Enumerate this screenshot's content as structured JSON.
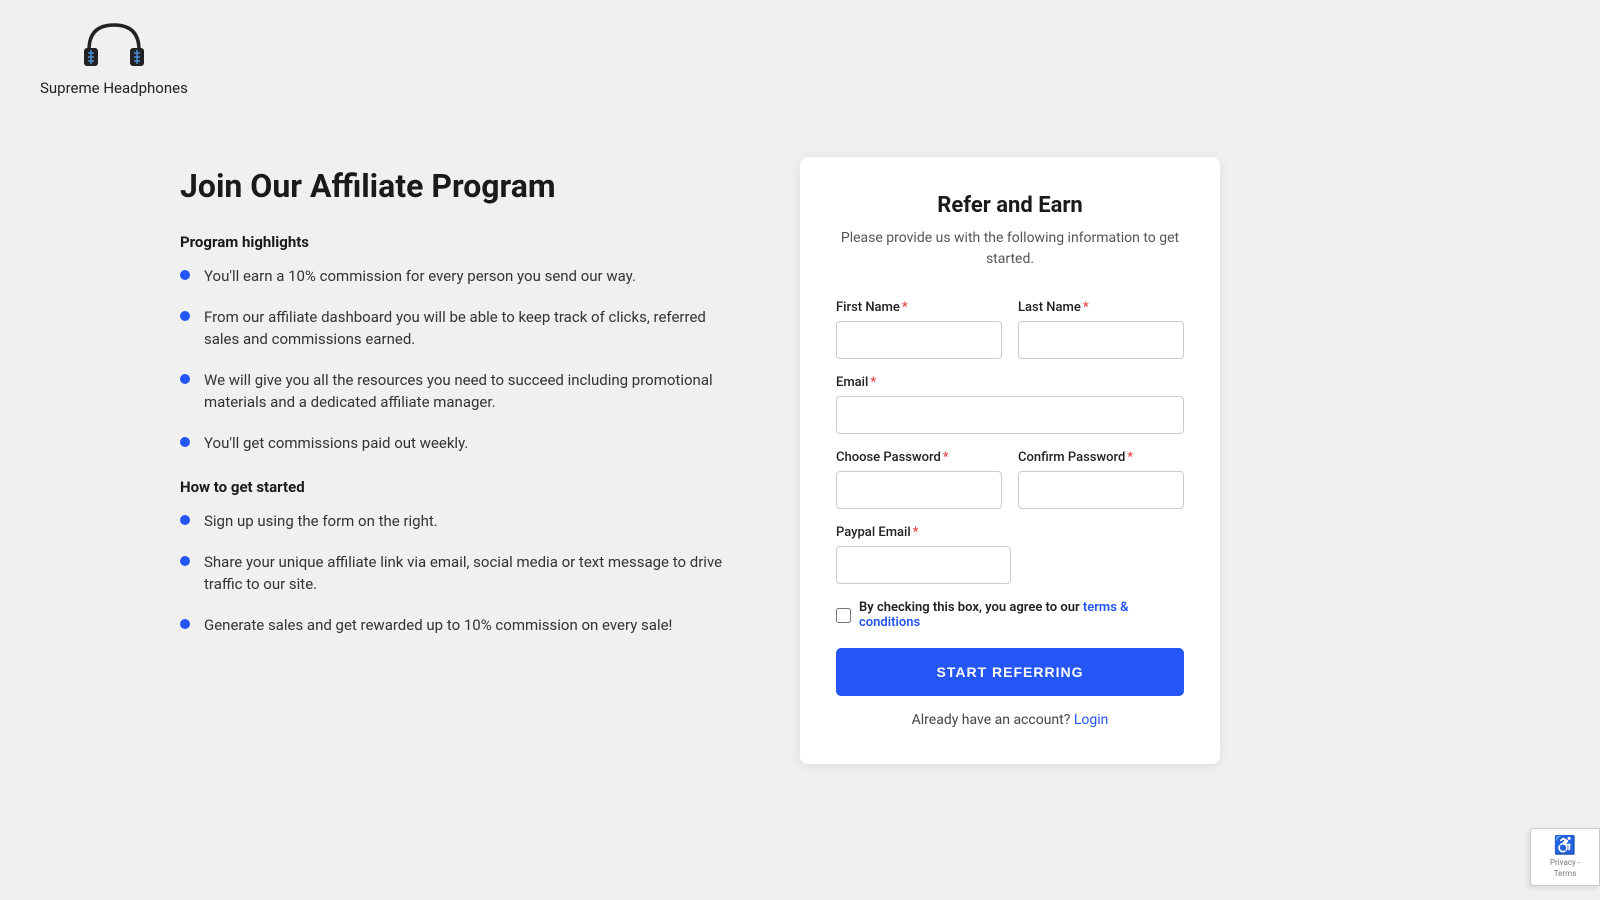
{
  "header": {
    "logo_text": "Supreme Headphones"
  },
  "left": {
    "page_title": "Join Our Affiliate Program",
    "highlights_heading": "Program highlights",
    "highlights": [
      "You'll earn a 10% commission for every person you send our way.",
      "From our affiliate dashboard you will be able to keep track of clicks, referred sales and commissions earned.",
      "We will give you all the resources you need to succeed including promotional materials and a dedicated affiliate manager.",
      "You'll get commissions paid out weekly."
    ],
    "howto_heading": "How to get started",
    "howto": [
      "Sign up using the form on the right.",
      "Share your unique affiliate link via email, social media or text message to drive traffic to our site.",
      "Generate sales and get rewarded up to 10% commission on every sale!"
    ]
  },
  "form": {
    "title": "Refer and Earn",
    "subtitle": "Please provide us with the following information to get started.",
    "first_name_label": "First Name",
    "last_name_label": "Last Name",
    "email_label": "Email",
    "password_label": "Choose Password",
    "confirm_password_label": "Confirm Password",
    "paypal_email_label": "Paypal Email",
    "checkbox_text": "By checking this box, you agree to our ",
    "terms_text": "terms & conditions",
    "submit_label": "START REFERRING",
    "login_text": "Already have an account?",
    "login_link_text": "Login"
  },
  "recaptcha": {
    "text": "Privacy - Terms"
  }
}
